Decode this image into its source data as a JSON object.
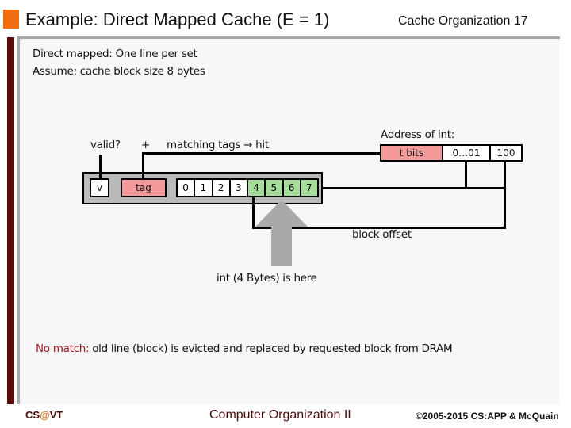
{
  "header": {
    "title": "Example: Direct Mapped Cache (E = 1)",
    "section": "Cache Organization",
    "page_number": "17"
  },
  "intro": {
    "line1": "Direct mapped: One line per set",
    "line2": "Assume: cache block size 8 bytes"
  },
  "diagram": {
    "valid_label": "valid?",
    "plus_label": "+",
    "matching_label": "matching tags → hit",
    "line": {
      "valid_field": "v",
      "tag_field": "tag",
      "bytes": [
        "0",
        "1",
        "2",
        "3",
        "4",
        "5",
        "6",
        "7"
      ],
      "highlighted_bytes": [
        "4",
        "5",
        "6",
        "7"
      ]
    },
    "address": {
      "label": "Address of int:",
      "tag_bits": "t bits",
      "set_index": "0…01",
      "block_offset": "100"
    },
    "block_offset_label": "block offset",
    "int_label": "int (4 Bytes) is here"
  },
  "no_match": {
    "prefix": "No match:",
    "text": " old line (block) is evicted and replaced by requested block from DRAM"
  },
  "footer": {
    "left_cs": "CS",
    "left_at": "@",
    "left_vt": "VT",
    "center": "Computer Organization II",
    "right": "©2005-2015 CS:APP & McQuain"
  },
  "colors": {
    "accent_orange": "#f26b0f",
    "bar_maroon": "#5c0a0a",
    "tag_pink": "#f49a9a",
    "byte_green": "#a6dd9b",
    "line_gray": "#b9b9b9",
    "arrow_gray": "#a9a9a9",
    "no_match_red": "#a0141e"
  }
}
